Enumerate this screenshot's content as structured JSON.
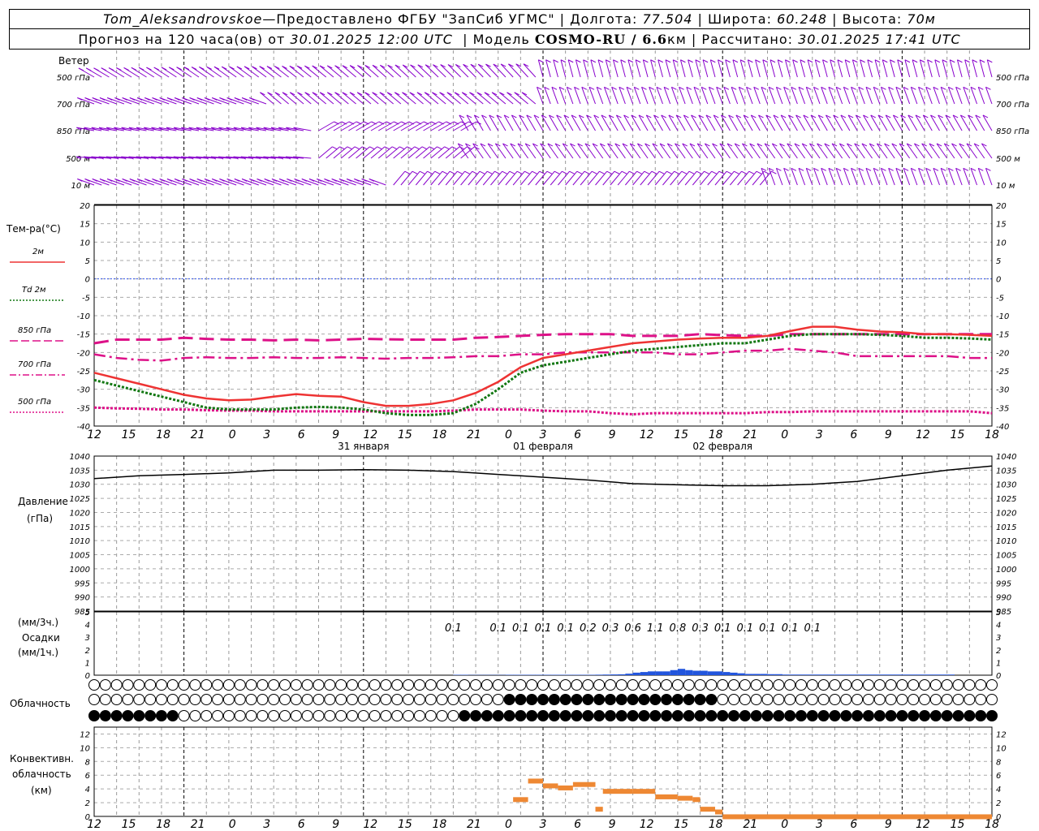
{
  "header": {
    "station": "Tom_Aleksandrovskoe",
    "dash": " — ",
    "provider": "Предоставлено ФГБУ \"ЗапСиб УГМС\"",
    "lon_label": "Долгота:",
    "lon_value": "77.504",
    "lat_label": "Широта:",
    "lat_value": "60.248",
    "alt_label": "Высота:",
    "alt_value": "70м",
    "forecast_label": "Прогноз на 120 часа(ов) от",
    "forecast_time": "30.01.2025 12:00 UTC",
    "model_label": "Модель",
    "model_name": "COSMO-RU / 6.6",
    "model_unit": "км",
    "calc_label": "Рассчитано:",
    "calc_time": "30.01.2025 17:41 UTC"
  },
  "wind": {
    "title": "Ветер",
    "levels": [
      "500 гПа",
      "700 гПа",
      "850 гПа",
      "500 м",
      "10  м"
    ],
    "color": "#8800cc"
  },
  "temperature": {
    "title": "Тем-ра(°C)",
    "legend": [
      {
        "label": "2м",
        "color": "#ee3333",
        "style": "solid"
      },
      {
        "label": "Td  2м",
        "color": "#117711",
        "style": "dotted"
      },
      {
        "label": "850 гПа",
        "color": "#dd1188",
        "style": "dashed"
      },
      {
        "label": "700 гПа",
        "color": "#dd1188",
        "style": "dashdot"
      },
      {
        "label": "500 гПа",
        "color": "#dd1188",
        "style": "dotted"
      }
    ]
  },
  "pressure": {
    "title": "Давление",
    "unit": "(гПа)"
  },
  "precip": {
    "unit3": "(мм/3ч.)",
    "title": "Осадки",
    "unit1": "(мм/1ч.)"
  },
  "cloud": {
    "title": "Облачность"
  },
  "convective": {
    "title1": "Конвективн.",
    "title2": "облачность",
    "unit": "(км)"
  },
  "time_axis": {
    "ticks": [
      "12",
      "15",
      "18",
      "21",
      "0",
      "3",
      "6",
      "9",
      "12",
      "15",
      "18",
      "21",
      "0",
      "3",
      "6",
      "9",
      "12",
      "15",
      "18",
      "21",
      "0",
      "3",
      "6",
      "9",
      "12",
      "15",
      "18"
    ],
    "dates": [
      "31 января",
      "01 февраля",
      "02 февраля"
    ]
  },
  "chart_data": [
    {
      "type": "line",
      "name": "temperature",
      "x": [
        0,
        3,
        6,
        9,
        12,
        15,
        18,
        21,
        24,
        27,
        30,
        33,
        36,
        39,
        42,
        45,
        48,
        51,
        54,
        57,
        60,
        63,
        66,
        69,
        72,
        75,
        78,
        81,
        84,
        87,
        90,
        93,
        96,
        99,
        102,
        105,
        108,
        111,
        114,
        117,
        120
      ],
      "series": [
        {
          "name": "2м",
          "values": [
            -25.5,
            -27,
            -28.5,
            -30,
            -31.5,
            -32.5,
            -33,
            -32.8,
            -32,
            -31.3,
            -31.8,
            -32,
            -33.5,
            -34.5,
            -34.5,
            -34,
            -33,
            -31,
            -28,
            -24,
            -21.5,
            -20.5,
            -19.5,
            -18.5,
            -17.5,
            -17,
            -16.5,
            -16.2,
            -16,
            -16,
            -15.5,
            -14.2,
            -13,
            -13,
            -13.8,
            -14.3,
            -14.5,
            -15,
            -15,
            -15.2,
            -15.5
          ]
        },
        {
          "name": "Td  2м",
          "values": [
            -27.5,
            -29,
            -30.5,
            -32,
            -33.5,
            -35,
            -35.5,
            -35.5,
            -35.5,
            -35,
            -34.8,
            -35,
            -35.5,
            -36.5,
            -37,
            -37,
            -36.5,
            -34,
            -30,
            -25.5,
            -23.5,
            -22.5,
            -21.5,
            -20.5,
            -19.5,
            -19,
            -18.5,
            -18,
            -17.5,
            -17.5,
            -16.5,
            -15.5,
            -15,
            -15,
            -15,
            -15.2,
            -15.5,
            -16,
            -16,
            -16.2,
            -16.5
          ]
        },
        {
          "name": "850 гПа",
          "values": [
            -17.5,
            -16.5,
            -16.5,
            -16.5,
            -16,
            -16.3,
            -16.5,
            -16.5,
            -16.7,
            -16.5,
            -16.7,
            -16.5,
            -16.3,
            -16.4,
            -16.5,
            -16.5,
            -16.5,
            -16,
            -15.8,
            -15.5,
            -15.2,
            -15,
            -15,
            -15,
            -15.5,
            -15.5,
            -15.5,
            -15,
            -15.3,
            -15.5,
            -15.5,
            -15,
            -15,
            -15,
            -15,
            -15,
            -15,
            -15,
            -15,
            -15,
            -15
          ]
        },
        {
          "name": "700 гПа",
          "values": [
            -20.5,
            -21.5,
            -22,
            -22.2,
            -21.5,
            -21.3,
            -21.5,
            -21.5,
            -21.3,
            -21.5,
            -21.5,
            -21.3,
            -21.5,
            -21.7,
            -21.5,
            -21.5,
            -21.3,
            -21,
            -21,
            -20.5,
            -20.5,
            -20,
            -20,
            -20,
            -20,
            -20,
            -20.5,
            -20.5,
            -20,
            -19.5,
            -19.5,
            -19,
            -19.5,
            -20,
            -21,
            -21,
            -21,
            -21,
            -21,
            -21.5,
            -21.5
          ]
        },
        {
          "name": "500 гПа",
          "values": [
            -35,
            -35.2,
            -35.3,
            -35.5,
            -35.5,
            -35.7,
            -35.8,
            -35.8,
            -36,
            -36,
            -36,
            -36,
            -36,
            -36,
            -36,
            -36,
            -35.8,
            -35.5,
            -35.5,
            -35.5,
            -35.8,
            -36,
            -36,
            -36.5,
            -36.8,
            -36.5,
            -36.5,
            -36.5,
            -36.5,
            -36.5,
            -36.2,
            -36.2,
            -36,
            -36,
            -36,
            -36,
            -36,
            -36,
            -36,
            -36,
            -36.5
          ]
        }
      ],
      "ylim": [
        -40,
        20
      ]
    },
    {
      "type": "line",
      "name": "pressure",
      "x": [
        0,
        6,
        12,
        18,
        24,
        30,
        36,
        42,
        48,
        54,
        60,
        66,
        72,
        78,
        84,
        90,
        96,
        102,
        108,
        114,
        120
      ],
      "values": [
        1032,
        1033,
        1033.5,
        1034,
        1035,
        1035,
        1035.2,
        1035,
        1034.5,
        1033.5,
        1032.5,
        1031.5,
        1030.2,
        1029.8,
        1029.5,
        1029.5,
        1030,
        1031,
        1033,
        1035,
        1036.5
      ],
      "ylim": [
        985,
        1040
      ]
    },
    {
      "type": "bar",
      "name": "precipitation",
      "labels_3h": [
        {
          "x": 48,
          "text": "0.1"
        },
        {
          "x": 54,
          "text": "0.1"
        },
        {
          "x": 57,
          "text": "0.1"
        },
        {
          "x": 60,
          "text": "0.1"
        },
        {
          "x": 63,
          "text": "0.1"
        },
        {
          "x": 66,
          "text": "0.2"
        },
        {
          "x": 69,
          "text": "0.3"
        },
        {
          "x": 72,
          "text": "0.6"
        },
        {
          "x": 75,
          "text": "1.1"
        },
        {
          "x": 78,
          "text": "0.8"
        },
        {
          "x": 81,
          "text": "0.3"
        },
        {
          "x": 84,
          "text": "0.1"
        },
        {
          "x": 87,
          "text": "0.1"
        },
        {
          "x": 90,
          "text": "0.1"
        },
        {
          "x": 93,
          "text": "0.1"
        },
        {
          "x": 96,
          "text": "0.1"
        }
      ],
      "hourly_x": [
        49,
        50,
        51,
        52,
        53,
        54,
        55,
        56,
        57,
        58,
        59,
        60,
        61,
        62,
        63,
        64,
        65,
        66,
        67,
        68,
        69,
        70,
        71,
        72,
        73,
        74,
        75,
        76,
        77,
        78,
        79,
        80,
        81,
        82,
        83,
        84,
        85,
        86,
        87,
        88,
        89,
        90,
        91,
        92,
        93,
        94,
        95,
        96,
        97,
        98,
        99,
        100,
        101,
        102,
        103,
        104,
        105,
        106,
        107,
        108,
        109,
        110,
        111,
        112,
        113,
        114,
        115
      ],
      "hourly_values": [
        0.03,
        0.03,
        0.02,
        0.02,
        0.02,
        0.02,
        0.02,
        0.03,
        0.03,
        0.03,
        0.03,
        0.03,
        0.03,
        0.03,
        0.03,
        0.03,
        0.03,
        0.03,
        0.03,
        0.04,
        0.05,
        0.06,
        0.07,
        0.12,
        0.2,
        0.25,
        0.3,
        0.3,
        0.3,
        0.4,
        0.5,
        0.4,
        0.35,
        0.35,
        0.3,
        0.3,
        0.25,
        0.2,
        0.15,
        0.1,
        0.1,
        0.1,
        0.08,
        0.08,
        0.05,
        0.05,
        0.05,
        0.05,
        0.05,
        0.05,
        0.05,
        0.05,
        0.05,
        0.05,
        0.05,
        0.05,
        0.05,
        0.05,
        0.05,
        0.05,
        0.05,
        0.05,
        0.05,
        0.05,
        0.05,
        0.05,
        0.05
      ],
      "ylim": [
        0,
        5
      ]
    },
    {
      "type": "bar",
      "name": "convective_cloud",
      "segments": [
        {
          "x0": 56,
          "x1": 58,
          "top": 2.8
        },
        {
          "x0": 58,
          "x1": 60,
          "top": 5.5
        },
        {
          "x0": 60,
          "x1": 62,
          "top": 4.8
        },
        {
          "x0": 62,
          "x1": 64,
          "top": 4.5
        },
        {
          "x0": 64,
          "x1": 67,
          "top": 5
        },
        {
          "x0": 67,
          "x1": 68,
          "top": 1.4
        },
        {
          "x0": 68,
          "x1": 72,
          "top": 4
        },
        {
          "x0": 72,
          "x1": 75,
          "top": 4
        },
        {
          "x0": 75,
          "x1": 78,
          "top": 3.2
        },
        {
          "x0": 78,
          "x1": 80,
          "top": 3
        },
        {
          "x0": 80,
          "x1": 81,
          "top": 2.8
        },
        {
          "x0": 81,
          "x1": 83,
          "top": 1.4
        },
        {
          "x0": 83,
          "x1": 84,
          "top": 1
        },
        {
          "x0": 84,
          "x1": 120,
          "top": 0.3
        }
      ],
      "ylim": [
        0,
        13
      ]
    }
  ]
}
